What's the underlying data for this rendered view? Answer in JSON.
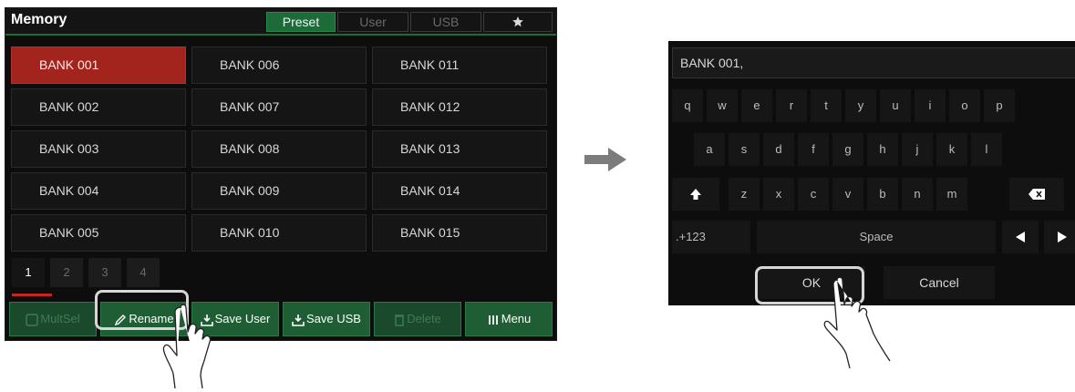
{
  "memory": {
    "title": "Memory",
    "tabs": [
      {
        "label": "Preset",
        "active": true
      },
      {
        "label": "User",
        "active": false
      },
      {
        "label": "USB",
        "active": false
      },
      {
        "icon": "star-icon",
        "active": false
      }
    ],
    "banks": [
      [
        "BANK 001",
        "BANK 006",
        "BANK 011"
      ],
      [
        "BANK 002",
        "BANK 007",
        "BANK 012"
      ],
      [
        "BANK 003",
        "BANK 008",
        "BANK 013"
      ],
      [
        "BANK 004",
        "BANK 009",
        "BANK 014"
      ],
      [
        "BANK 005",
        "BANK 010",
        "BANK 015"
      ]
    ],
    "selected_bank": "BANK 001",
    "pages": [
      "1",
      "2",
      "3",
      "4"
    ],
    "active_page": "1",
    "actions": [
      {
        "label": "MultSel",
        "icon": "multisel-icon",
        "enabled": false
      },
      {
        "label": "Rename",
        "icon": "pencil-icon",
        "enabled": true
      },
      {
        "label": "Save User",
        "icon": "save-user-icon",
        "enabled": true
      },
      {
        "label": "Save USB",
        "icon": "save-usb-icon",
        "enabled": true
      },
      {
        "label": "Delete",
        "icon": "trash-icon",
        "enabled": false
      },
      {
        "label": "Menu",
        "icon": "menu-icon",
        "enabled": true
      }
    ]
  },
  "keyboard": {
    "input_value": "BANK 001",
    "rows": [
      [
        "q",
        "w",
        "e",
        "r",
        "t",
        "y",
        "u",
        "i",
        "o",
        "p"
      ],
      [
        "a",
        "s",
        "d",
        "f",
        "g",
        "h",
        "j",
        "k",
        "l"
      ],
      [
        "shift-icon",
        "z",
        "x",
        "c",
        "v",
        "b",
        "n",
        "m",
        "backspace-icon"
      ]
    ],
    "symbols_label": ".+123",
    "space_label": "Space",
    "left_arrow_icon": "left-arrow-icon",
    "right_arrow_icon": "right-arrow-icon",
    "ok_label": "OK",
    "cancel_label": "Cancel"
  },
  "colors": {
    "selected_bank": "#a3231d",
    "accent_green": "#1d6b38",
    "page_indicator": "#c4261f"
  }
}
